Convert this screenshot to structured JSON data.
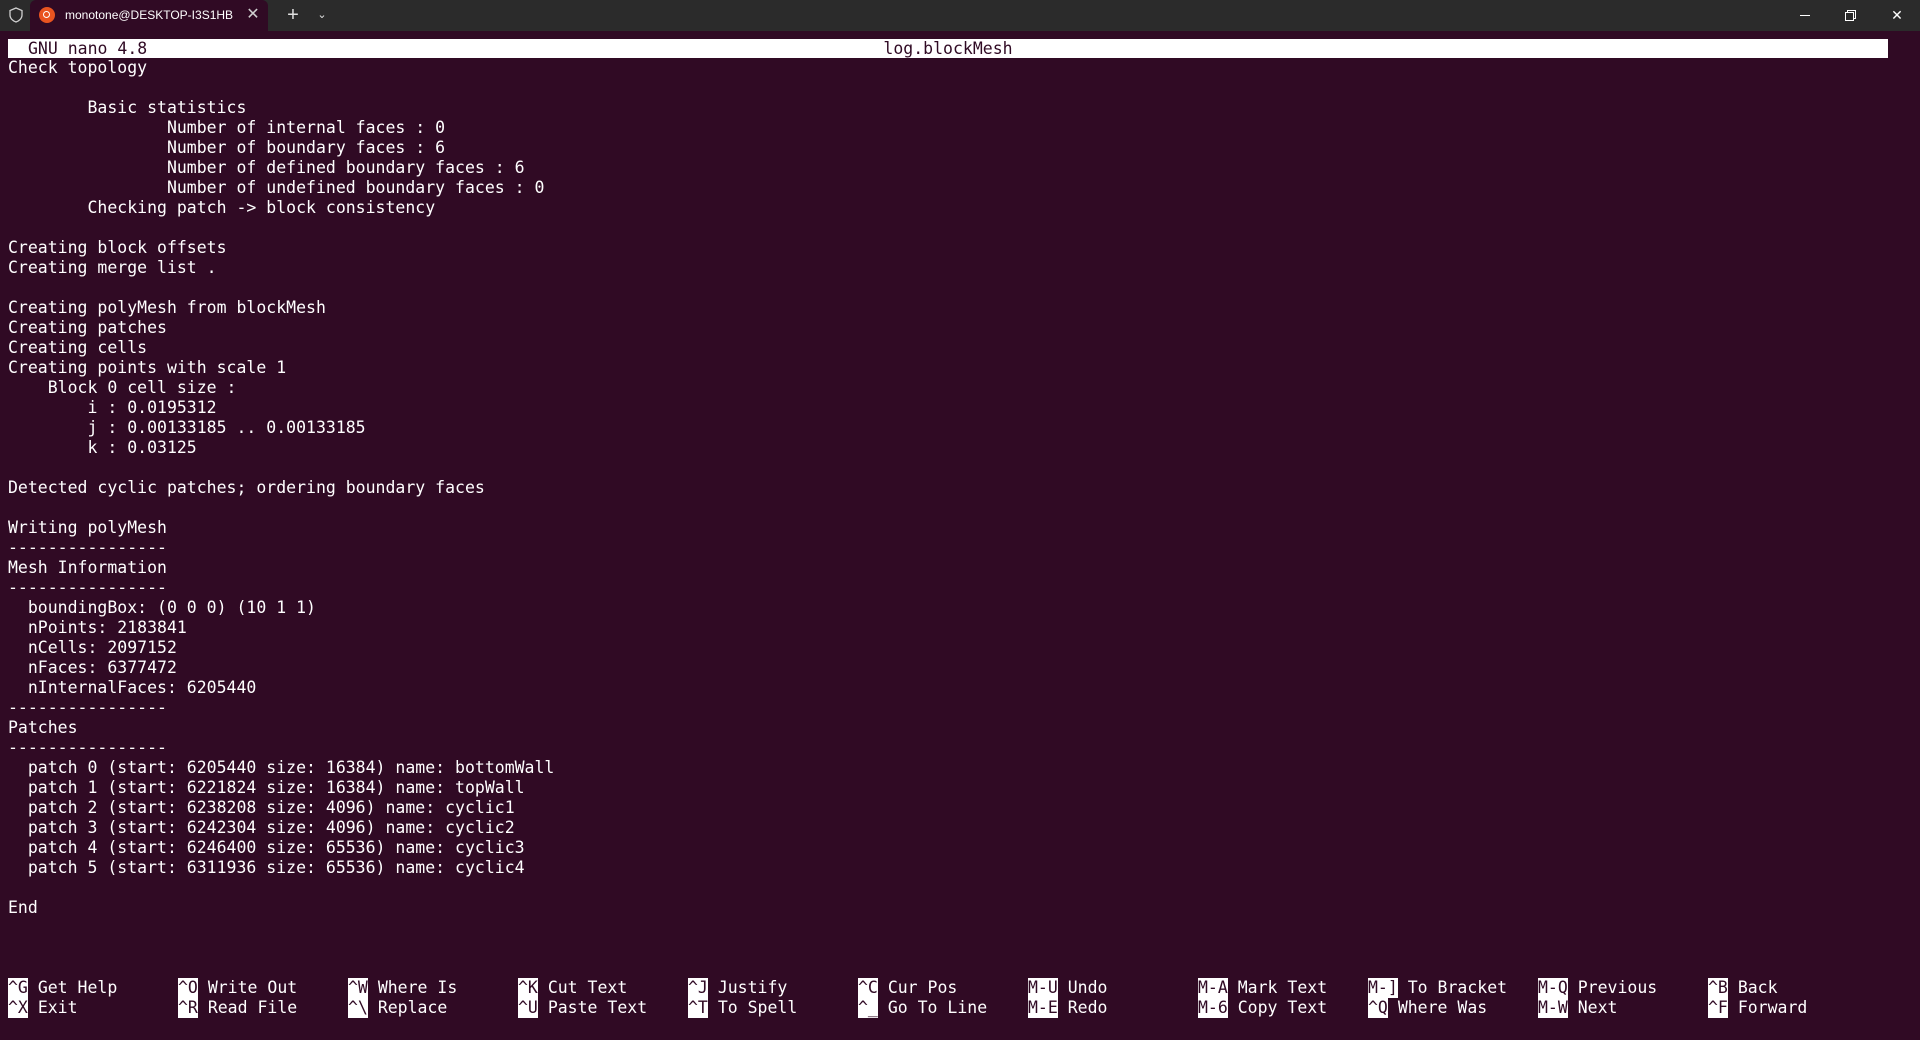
{
  "window": {
    "tab_title": "monotone@DESKTOP-I3S1HB",
    "tab_close": "✕",
    "new_tab": "+",
    "tab_dropdown": "⌄",
    "icons": {
      "shield": "shield-icon",
      "tab": "ubuntu-icon",
      "minimize": "minimize-icon",
      "restore": "restore-icon",
      "close": "close-icon"
    },
    "close_glyph": "✕"
  },
  "nano": {
    "version": "GNU nano 4.8",
    "filename": "log.blockMesh"
  },
  "buffer": {
    "lines": [
      "Check topology",
      "",
      "        Basic statistics",
      "                Number of internal faces : 0",
      "                Number of boundary faces : 6",
      "                Number of defined boundary faces : 6",
      "                Number of undefined boundary faces : 0",
      "        Checking patch -> block consistency",
      "",
      "Creating block offsets",
      "Creating merge list .",
      "",
      "Creating polyMesh from blockMesh",
      "Creating patches",
      "Creating cells",
      "Creating points with scale 1",
      "    Block 0 cell size :",
      "        i : 0.0195312",
      "        j : 0.00133185 .. 0.00133185",
      "        k : 0.03125",
      "",
      "Detected cyclic patches; ordering boundary faces",
      "",
      "Writing polyMesh",
      "----------------",
      "Mesh Information",
      "----------------",
      "  boundingBox: (0 0 0) (10 1 1)",
      "  nPoints: 2183841",
      "  nCells: 2097152",
      "  nFaces: 6377472",
      "  nInternalFaces: 6205440",
      "----------------",
      "Patches",
      "----------------",
      "  patch 0 (start: 6205440 size: 16384) name: bottomWall",
      "  patch 1 (start: 6221824 size: 16384) name: topWall",
      "  patch 2 (start: 6238208 size: 4096) name: cyclic1",
      "  patch 3 (start: 6242304 size: 4096) name: cyclic2",
      "  patch 4 (start: 6246400 size: 65536) name: cyclic3",
      "  patch 5 (start: 6311936 size: 65536) name: cyclic4",
      "",
      "End"
    ]
  },
  "shortcuts": [
    [
      {
        "key": "^G",
        "label": "Get Help"
      },
      {
        "key": "^O",
        "label": "Write Out"
      },
      {
        "key": "^W",
        "label": "Where Is"
      },
      {
        "key": "^K",
        "label": "Cut Text"
      },
      {
        "key": "^J",
        "label": "Justify"
      },
      {
        "key": "^C",
        "label": "Cur Pos"
      },
      {
        "key": "M-U",
        "label": "Undo"
      },
      {
        "key": "M-A",
        "label": "Mark Text"
      },
      {
        "key": "M-]",
        "label": "To Bracket"
      },
      {
        "key": "M-Q",
        "label": "Previous"
      },
      {
        "key": "^B",
        "label": "Back"
      }
    ],
    [
      {
        "key": "^X",
        "label": "Exit"
      },
      {
        "key": "^R",
        "label": "Read File"
      },
      {
        "key": "^\\",
        "label": "Replace"
      },
      {
        "key": "^U",
        "label": "Paste Text"
      },
      {
        "key": "^T",
        "label": "To Spell"
      },
      {
        "key": "^_",
        "label": "Go To Line"
      },
      {
        "key": "M-E",
        "label": "Redo"
      },
      {
        "key": "M-6",
        "label": "Copy Text"
      },
      {
        "key": "^Q",
        "label": "Where Was"
      },
      {
        "key": "M-W",
        "label": "Next"
      },
      {
        "key": "^F",
        "label": "Forward"
      }
    ]
  ],
  "colors": {
    "terminal_bg": "#300a24",
    "terminal_fg": "#ffffff",
    "titlebar_bg": "#2b2b2b",
    "ubuntu_orange": "#e95420"
  }
}
